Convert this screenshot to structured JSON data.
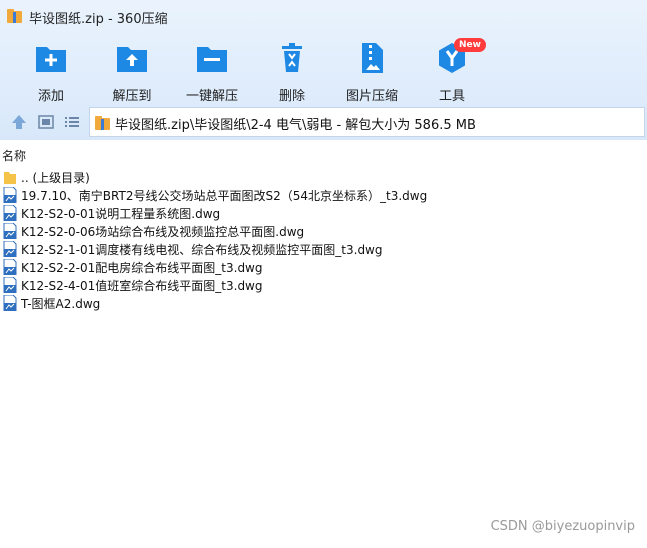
{
  "window": {
    "title": "毕设图纸.zip - 360压缩"
  },
  "toolbar": {
    "add": "添加",
    "extract_to": "解压到",
    "one_click_extract": "一键解压",
    "delete": "删除",
    "image_compress": "图片压缩",
    "tools": "工具",
    "tools_badge": "New"
  },
  "address": {
    "path": "毕设图纸.zip\\毕设图纸\\2-4 电气\\弱电 - 解包大小为 586.5 MB"
  },
  "list": {
    "column_name": "名称",
    "items": [
      {
        "name": ".. (上级目录)",
        "type": "folder"
      },
      {
        "name": "19.7.10、南宁BRT2号线公交场站总平面图改S2（54北京坐标系）_t3.dwg",
        "type": "dwg"
      },
      {
        "name": "K12-S2-0-01说明工程量系统图.dwg",
        "type": "dwg"
      },
      {
        "name": "K12-S2-0-06场站综合布线及视频监控总平面图.dwg",
        "type": "dwg"
      },
      {
        "name": "K12-S2-1-01调度楼有线电视、综合布线及视频监控平面图_t3.dwg",
        "type": "dwg"
      },
      {
        "name": "K12-S2-2-01配电房综合布线平面图_t3.dwg",
        "type": "dwg"
      },
      {
        "name": "K12-S2-4-01值班室综合布线平面图_t3.dwg",
        "type": "dwg"
      },
      {
        "name": "T-图框A2.dwg",
        "type": "dwg"
      }
    ]
  },
  "watermark": "CSDN @biyezuopinvip",
  "colors": {
    "accent": "#1e88e5",
    "toolbar_bg": "#deebfb",
    "badge": "#ff3b3b"
  }
}
